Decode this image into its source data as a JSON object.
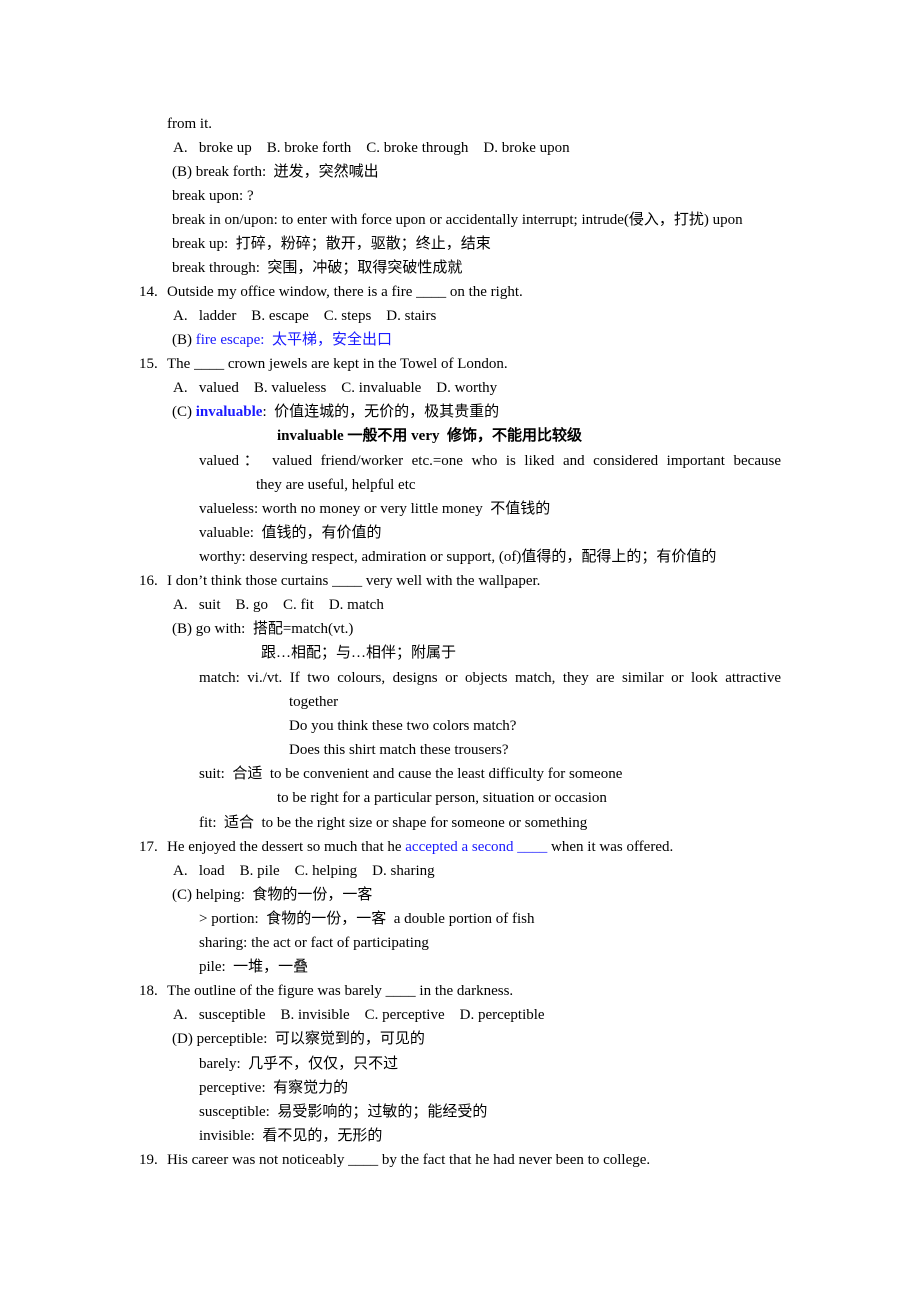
{
  "document": {
    "continuation": "from it.",
    "q13": {
      "options": "A.   broke up    B. broke forth    C. broke through    D. broke upon",
      "answer_label": "(B)",
      "answer_text": "break forth:  迸发，突然喊出",
      "notes": [
        "break upon: ?",
        "break in on/upon: to enter with force upon or accidentally interrupt; intrude(侵入，打扰) upon",
        "break up:  打碎，粉碎；散开，驱散；终止，结束",
        "break through:  突围，冲破；取得突破性成就"
      ]
    },
    "q14": {
      "number": "14.",
      "question": "Outside my office window, there is a fire ____ on the right.",
      "options": "A.   ladder    B. escape    C. steps    D. stairs",
      "answer_label": "(B)",
      "answer_text": "fire escape:  太平梯，安全出口"
    },
    "q15": {
      "number": "15.",
      "question": "The ____ crown jewels are kept in the Towel of London.",
      "options": "A.   valued    B. valueless    C. invaluable    D. worthy",
      "answer_label": "(C)",
      "answer_word": "invaluable",
      "answer_text": ":  价值连城的，无价的，极其贵重的",
      "bold_note": "invaluable 一般不用 very  修饰，不能用比较级",
      "valued_line1": "valued：  valued friend/worker etc.=one who is liked and considered important because",
      "valued_line2": "they are useful, helpful etc",
      "valueless": "valueless: worth no money or very little money  不值钱的",
      "valuable": "valuable:  值钱的，有价值的",
      "worthy": "worthy: deserving respect, admiration or support, (of)值得的，配得上的；有价值的"
    },
    "q16": {
      "number": "16.",
      "question": "I don’t think those curtains ____ very well with the wallpaper.",
      "options": "A.   suit    B. go    C. fit    D. match",
      "answer_label": "(B)",
      "answer_text": "go with:  搭配=match(vt.)",
      "answer_text2": "跟…相配；与…相伴；附属于",
      "match_line1": "match: vi./vt. If two colours, designs or objects match, they are similar or look attractive",
      "match_line2": "together",
      "match_ex1": "Do you think these two colors match?",
      "match_ex2": "Does this shirt match these trousers?",
      "suit_line1": "suit:  合适  to be convenient and cause the least difficulty for someone",
      "suit_line2": "to be right for a particular person, situation or occasion",
      "fit": "fit:  适合  to be the right size or shape for someone or something"
    },
    "q17": {
      "number": "17.",
      "question_pre": "He enjoyed the dessert so much that he ",
      "question_blue": "accepted a second ____",
      "question_post": " when it was offered.",
      "options": "A.   load    B. pile    C. helping    D. sharing",
      "answer_label": "(C)",
      "answer_text": "helping:  食物的一份，一客",
      "notes": [
        "> portion:  食物的一份，一客  a double portion of fish",
        "sharing: the act or fact of participating",
        "pile:  一堆，一叠"
      ]
    },
    "q18": {
      "number": "18.",
      "question": "The outline of the figure was barely ____ in the darkness.",
      "options": "A.   susceptible    B. invisible    C. perceptive    D. perceptible",
      "answer_label": "(D)",
      "answer_text": "perceptible:  可以察觉到的，可见的",
      "notes": [
        "barely:  几乎不，仅仅，只不过",
        "perceptive:  有察觉力的",
        "susceptible:  易受影响的；过敏的；能经受的",
        "invisible:  看不见的，无形的"
      ]
    },
    "q19": {
      "number": "19.",
      "question": "His career was not noticeably ____ by the fact that he had never been to college."
    }
  }
}
